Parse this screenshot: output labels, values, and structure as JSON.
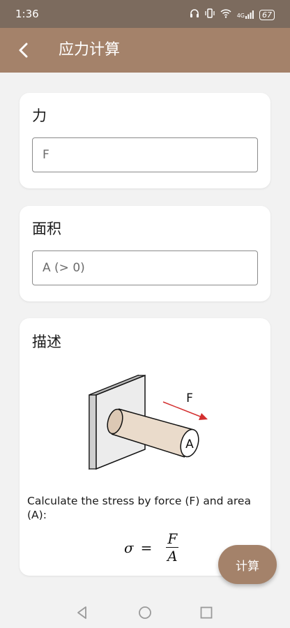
{
  "status": {
    "time": "1:36",
    "network": "4G",
    "battery": "67"
  },
  "appbar": {
    "title": "应力计算"
  },
  "force_card": {
    "title": "力",
    "placeholder": "F"
  },
  "area_card": {
    "title": "面积",
    "placeholder": "A (> 0)"
  },
  "desc_card": {
    "title": "描述",
    "figure_force_label": "F",
    "figure_area_label": "A",
    "text": "Calculate the stress by force (F) and area (A):",
    "formula": {
      "lhs": "σ",
      "eq": "=",
      "numerator": "F",
      "denominator": "A"
    }
  },
  "fab": {
    "label": "计算"
  },
  "colors": {
    "status_bar": "#7c6b5e",
    "app_bar": "#a4826a",
    "arrow": "#d32f2f",
    "rod": "#eadbcb"
  }
}
